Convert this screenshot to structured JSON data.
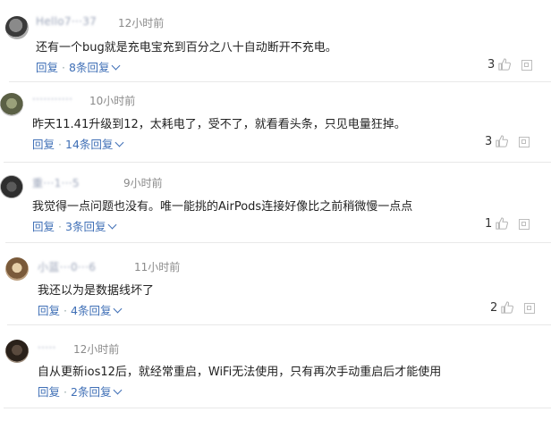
{
  "comments": [
    {
      "username": "Hello7···37",
      "time": "12小时前",
      "text": "还有一个bug就是充电宝充到百分之八十自动断开不充电。",
      "reply_label": "回复",
      "replies_label": "8条回复",
      "likes": "3"
    },
    {
      "username": "···········",
      "time": "10小时前",
      "text": "昨天11.41升级到12，太耗电了，受不了，就看看头条，只见电量狂掉。",
      "reply_label": "回复",
      "replies_label": "14条回复",
      "likes": "3"
    },
    {
      "username": "重···1···5",
      "time": "9小时前",
      "text": "我觉得一点问题也没有。唯一能挑的AirPods连接好像比之前稍微慢一点点",
      "reply_label": "回复",
      "replies_label": "3条回复",
      "likes": "1"
    },
    {
      "username": "小蓝···0···6",
      "time": "11小时前",
      "text": "我还以为是数据线坏了",
      "reply_label": "回复",
      "replies_label": "4条回复",
      "likes": "2"
    },
    {
      "username": "·····",
      "time": "12小时前",
      "text": "自从更新ios12后，就经常重启，WiFi无法使用，只有再次手动重启后才能使用",
      "reply_label": "回复",
      "replies_label": "2条回复",
      "likes": ""
    }
  ]
}
